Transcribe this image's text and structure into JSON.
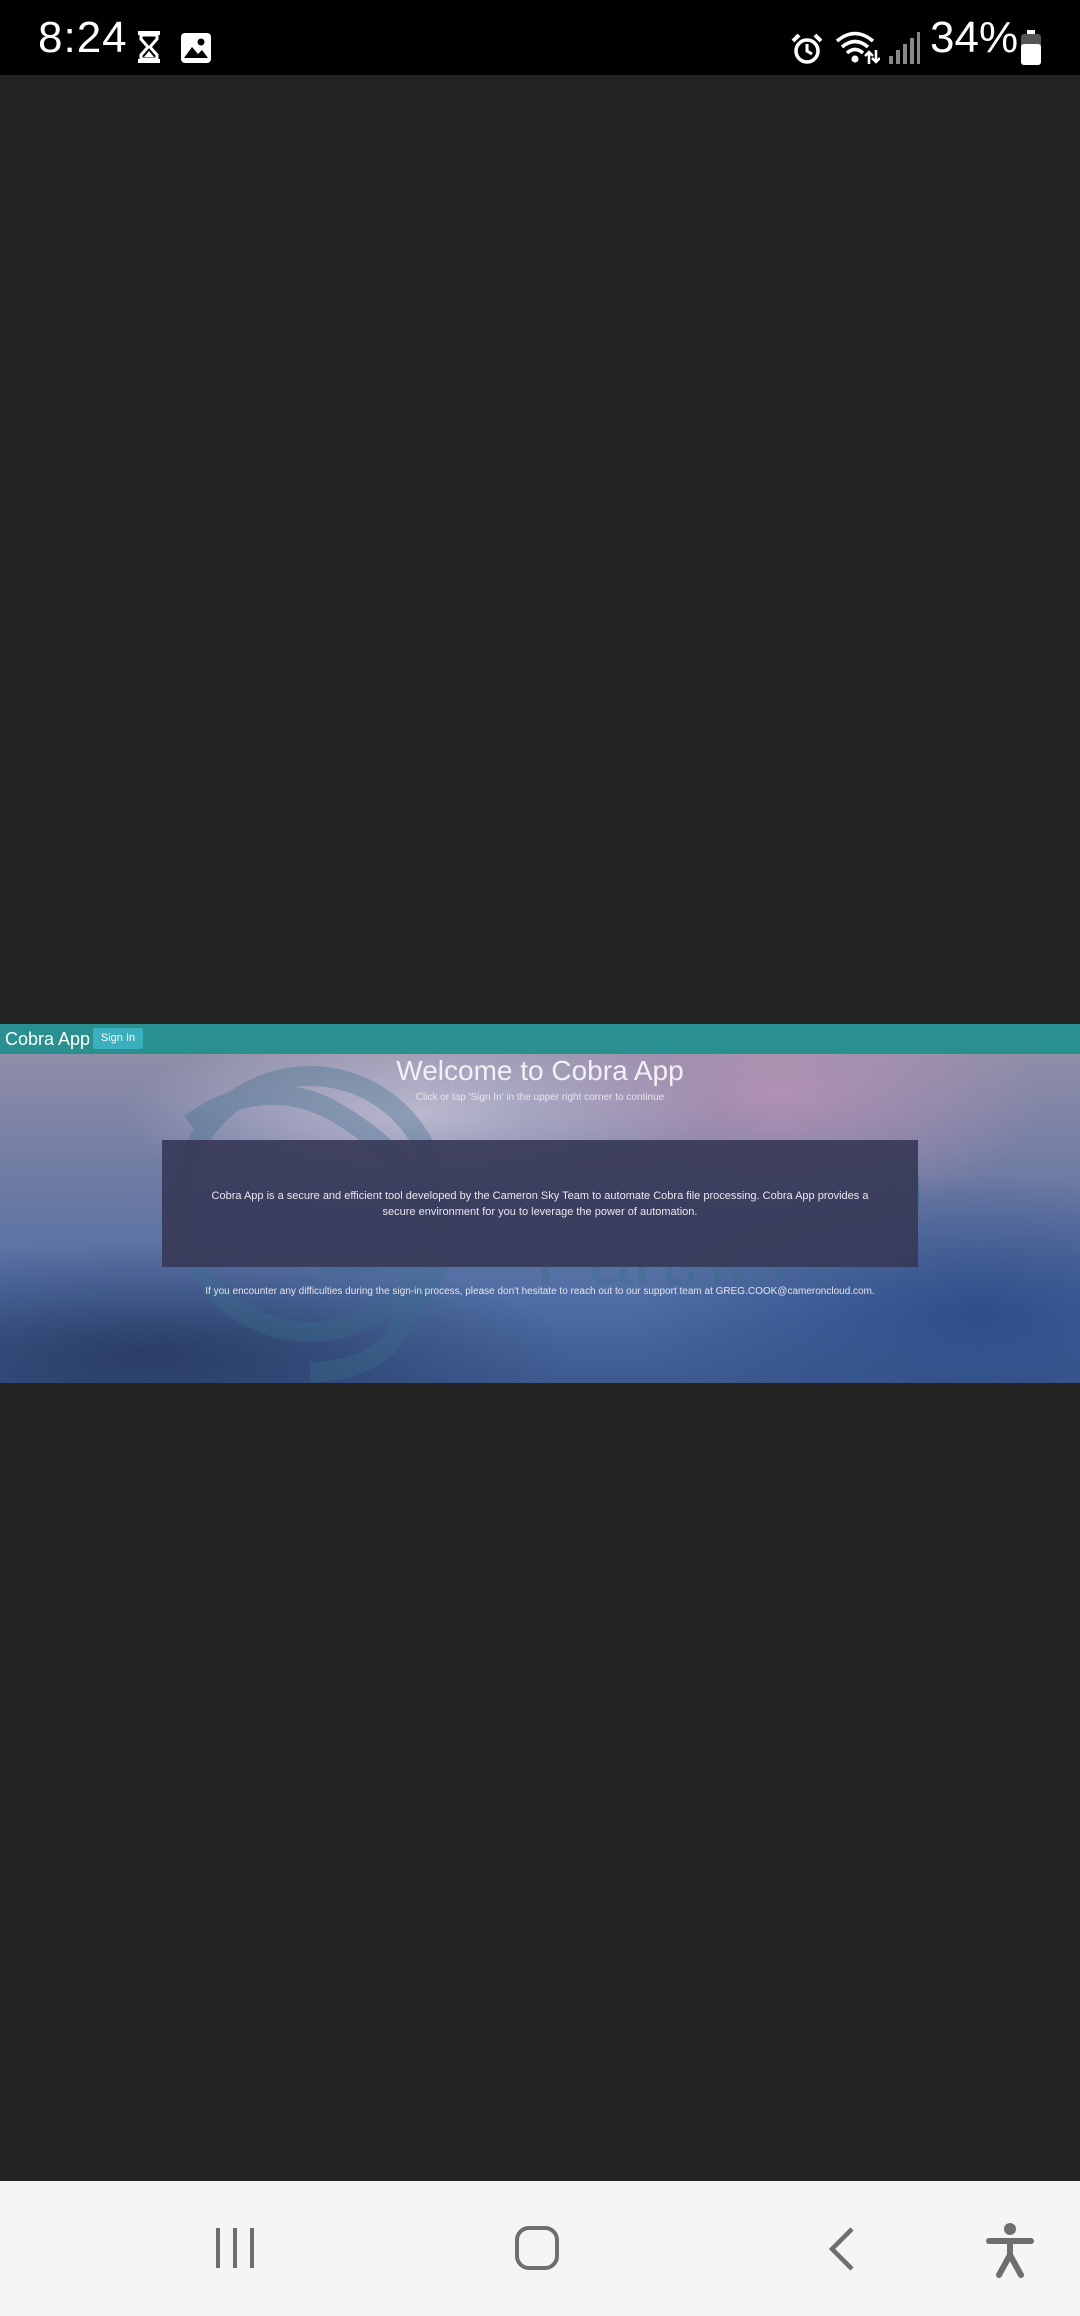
{
  "status_bar": {
    "time": "8:24",
    "battery": "34%",
    "left_icons": [
      "hourglass-icon",
      "image-icon"
    ],
    "right_icons": [
      "alarm-icon",
      "wifi-icon",
      "signal-icon",
      "battery-icon"
    ]
  },
  "app": {
    "brand": "Cobra App",
    "sign_in_label": "Sign In",
    "navbar_color": "#2a8f8f",
    "button_color": "#3ab0bf"
  },
  "hero": {
    "title": "Welcome to Cobra App",
    "subtitle": "Click or tap 'Sign In' in the upper right corner to continue",
    "description": "Cobra App is a secure and efficient tool developed by the Cameron Sky Team to automate Cobra file processing. Cobra App provides a secure environment for you to leverage the power of automation.",
    "support": "If you encounter any difficulties during the sign-in process, please don't hesitate to reach out to our support team at GREG.COOK@cameroncloud.com.",
    "watermark_text": [
      "n",
      "Partners"
    ]
  },
  "navigation_bar": {
    "buttons": [
      "recent-apps",
      "home",
      "back",
      "accessibility"
    ]
  }
}
